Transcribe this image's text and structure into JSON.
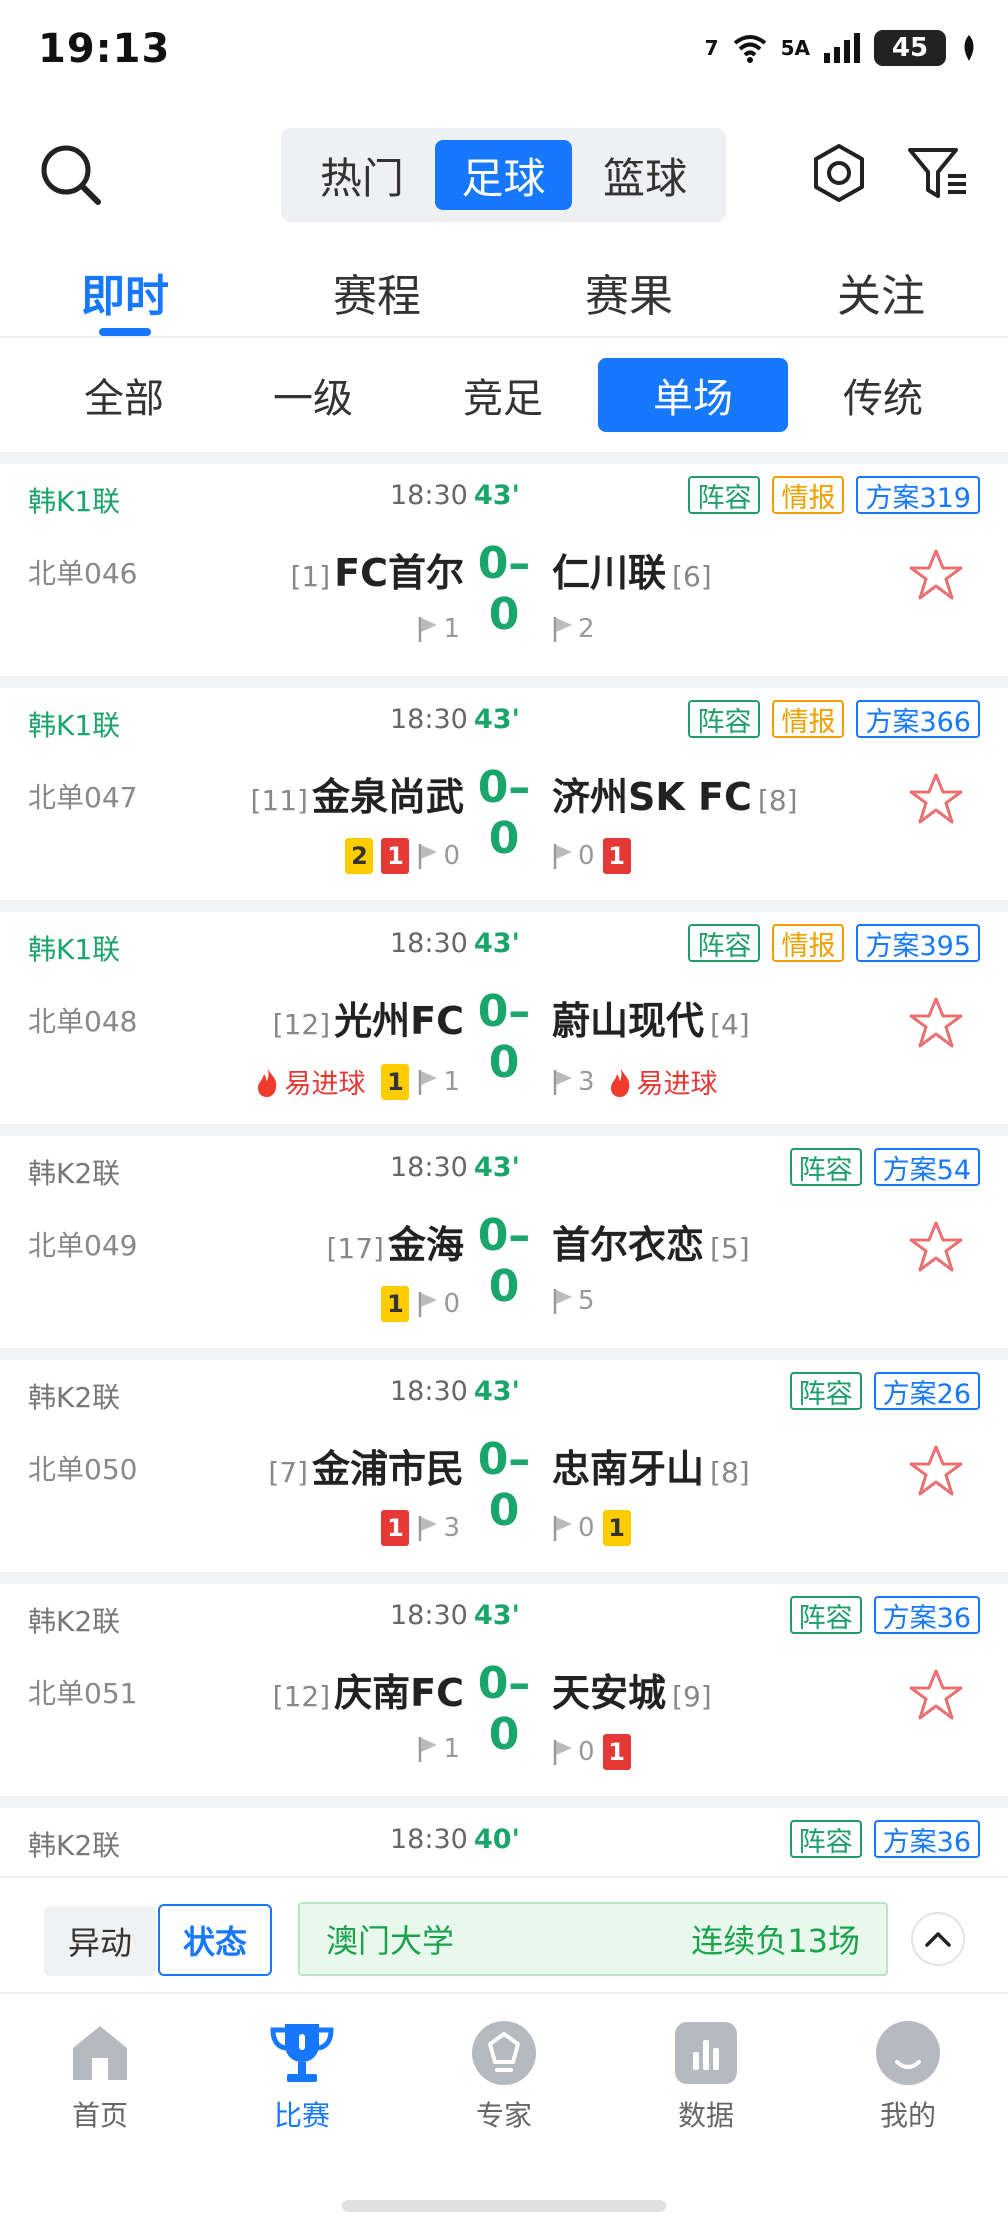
{
  "status_bar": {
    "time": "19:13",
    "wifi_label": "7",
    "signal_label": "5A",
    "battery": "45"
  },
  "top": {
    "sport_tabs": [
      "热门",
      "足球",
      "篮球"
    ],
    "active_sport": "足球"
  },
  "tabs": [
    "即时",
    "赛程",
    "赛果",
    "关注"
  ],
  "active_tab": "即时",
  "filters": [
    "全部",
    "一级",
    "竞足",
    "单场",
    "传统"
  ],
  "active_filter": "单场",
  "matches": [
    {
      "league": "韩K1联",
      "time": "18:30",
      "minute": "43'",
      "code": "北单046",
      "home": {
        "rank": "[1]",
        "name": "FC首尔"
      },
      "score": "0–0",
      "away": {
        "name": "仁川联",
        "rank": "[6]"
      },
      "tags": [
        "阵容",
        "情报",
        "方案319"
      ],
      "home_corners": "1",
      "away_corners": "2"
    },
    {
      "league": "韩K1联",
      "time": "18:30",
      "minute": "43'",
      "code": "北单047",
      "home": {
        "rank": "[11]",
        "name": "金泉尚武"
      },
      "score": "0–0",
      "away": {
        "name": "济州SK FC",
        "rank": "[8]"
      },
      "tags": [
        "阵容",
        "情报",
        "方案366"
      ],
      "home_yellow": "2",
      "home_red": "1",
      "home_corners": "0",
      "away_corners": "0",
      "away_red": "1"
    },
    {
      "league": "韩K1联",
      "time": "18:30",
      "minute": "43'",
      "code": "北单048",
      "home": {
        "rank": "[12]",
        "name": "光州FC"
      },
      "score": "0–0",
      "away": {
        "name": "蔚山现代",
        "rank": "[4]"
      },
      "tags": [
        "阵容",
        "情报",
        "方案395"
      ],
      "hot_label": "易进球",
      "home_yellow": "1",
      "home_corners": "1",
      "away_corners": "3"
    },
    {
      "league": "韩K2联",
      "time": "18:30",
      "minute": "43'",
      "code": "北单049",
      "home": {
        "rank": "[17]",
        "name": "金海"
      },
      "score": "0–0",
      "away": {
        "name": "首尔衣恋",
        "rank": "[5]"
      },
      "tags": [
        "阵容",
        "方案54"
      ],
      "home_yellow": "1",
      "home_corners": "0",
      "away_corners": "5"
    },
    {
      "league": "韩K2联",
      "time": "18:30",
      "minute": "43'",
      "code": "北单050",
      "home": {
        "rank": "[7]",
        "name": "金浦市民"
      },
      "score": "0–0",
      "away": {
        "name": "忠南牙山",
        "rank": "[8]"
      },
      "tags": [
        "阵容",
        "方案26"
      ],
      "home_red": "1",
      "home_corners": "3",
      "away_corners": "0",
      "away_yellow": "1"
    },
    {
      "league": "韩K2联",
      "time": "18:30",
      "minute": "43'",
      "code": "北单051",
      "home": {
        "rank": "[12]",
        "name": "庆南FC"
      },
      "score": "0–0",
      "away": {
        "name": "天安城",
        "rank": "[9]"
      },
      "tags": [
        "阵容",
        "方案36"
      ],
      "home_corners": "1",
      "away_corners": "0",
      "away_red": "1"
    },
    {
      "league": "韩K2联",
      "time": "18:30",
      "minute": "40'",
      "tags": [
        "阵容",
        "方案36"
      ]
    }
  ],
  "status_strip": {
    "btn_yidong": "异动",
    "btn_status": "状态",
    "team": "澳门大学",
    "text": "连续负13场"
  },
  "bottom_nav": [
    "首页",
    "比赛",
    "专家",
    "数据",
    "我的"
  ],
  "active_nav": "比赛",
  "colors": {
    "accent": "#1677ff",
    "score_green": "#1aa56a",
    "red_card": "#e53935",
    "yellow_card": "#ffcc00"
  }
}
